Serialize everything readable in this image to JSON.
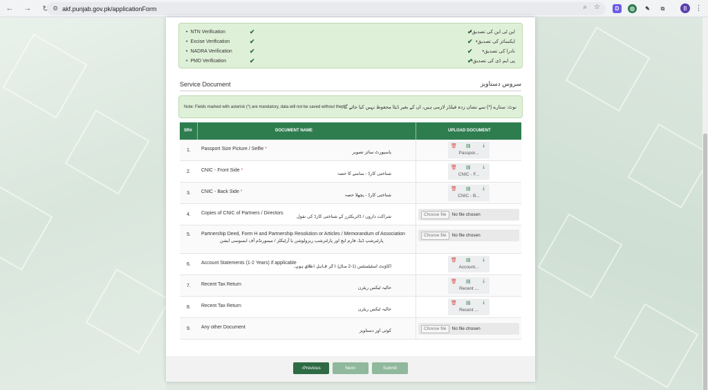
{
  "browser": {
    "url": "akf.punjab.gov.pk/applicationForm",
    "profile_initial": "B",
    "ext_initial": "D"
  },
  "verification": [
    {
      "en": "NTN Verification",
      "ur": "این ٹی این کی تصدیق"
    },
    {
      "en": "Excise Verification",
      "ur": "ایکسائز کی تصدیق"
    },
    {
      "en": "NADRA Verification",
      "ur": "نادرا کی تصدیق"
    },
    {
      "en": "PMD Verification",
      "ur": "پی ایم ڈی کی تصدیق"
    }
  ],
  "section": {
    "title": "Service Document",
    "title_ur": "سروس دستاویز"
  },
  "note": {
    "en": "Note: Fields marked with asterisk (*) are mandatory, data will not be saved without them.",
    "ur": "نوٹ: ستارے (*) سے نشان زدہ فیلڈز لازمی ہیں، ان کے بغیر ڈیٹا محفوظ نہیں کیا جائے گا۔"
  },
  "table": {
    "headers": {
      "sr": "SR#",
      "name": "DOCUMENT NAME",
      "upload": "UPLOAD DOCUMENT"
    },
    "rows": [
      {
        "sr": "1.",
        "name": "Passport Size Picture / Selfie",
        "req": "*",
        "ur": "پاسپورٹ سائز تصویر",
        "file": "Passpor..."
      },
      {
        "sr": "2.",
        "name": "CNIC - Front Side",
        "req": "*",
        "ur": "شناختی کارڈ - سامنے کا حصہ",
        "file": "CNIC - F..."
      },
      {
        "sr": "3.",
        "name": "CNIC - Back Side",
        "req": "*",
        "ur": "شناختی کارڈ - پچھلا حصہ",
        "file": "CNIC - B..."
      },
      {
        "sr": "4.",
        "name": "Copies of CNIC of Partners / Directors",
        "req": "",
        "ur": "شراکت داروں / ڈائریکٹرز کے شناختی کارڈ کی نقول",
        "choose": "Choose file",
        "nofile": "No file chosen"
      },
      {
        "sr": "5.",
        "name": "Partnership Deed, Form H and Partnership Resolution or Articles / Memorandum of Association",
        "req": "",
        "ur": "پارٹنرشپ ڈیڈ، فارم ایچ اور پارٹنرشپ ریزولوشن یا آرٹیکلز / میمورنڈم آف ایسوسی ایشن",
        "choose": "Choose file",
        "nofile": "No file chosen"
      },
      {
        "sr": "6.",
        "name": "Account Statements (1-2 Years) if applicable",
        "req": "",
        "ur": "اکاؤنٹ اسٹیٹمنٹس (1-2 سال) اگر قابل اطلاق ہوں۔",
        "file": "Account..."
      },
      {
        "sr": "7.",
        "name": "Recent Tax Return",
        "req": "",
        "ur": "حالیہ ٹیکس ریٹرن",
        "file": "Recent ..."
      },
      {
        "sr": "8.",
        "name": "Recent Tax Return",
        "req": "",
        "ur": "حالیہ ٹیکس ریٹرن",
        "file": "Recent ..."
      },
      {
        "sr": "9.",
        "name": "Any other Document",
        "req": "",
        "ur": "کوئی اور دستاویز",
        "choose": "Choose file",
        "nofile": "No file chosen"
      }
    ]
  },
  "buttons": {
    "prev": "Previous",
    "next": "Next",
    "submit": "Submit"
  },
  "icons": {
    "check": "✔",
    "delete": "trash-icon",
    "file": "file-icon",
    "download": "download-icon"
  }
}
